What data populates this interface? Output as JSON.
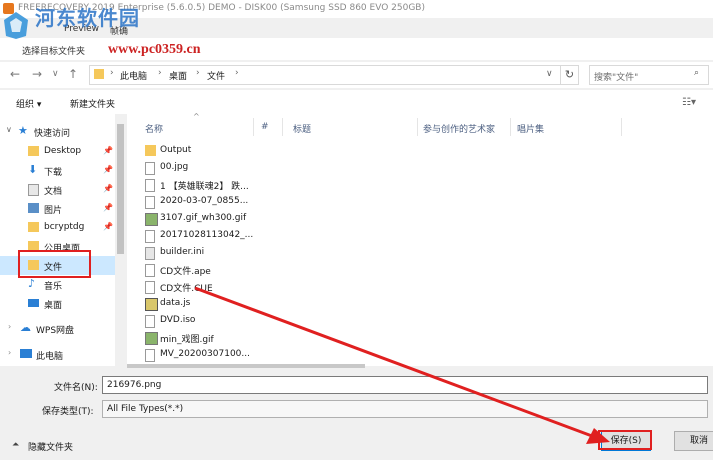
{
  "window": {
    "title": "FREERECOVERY 2019 Enterprise (5.6.0.5) DEMO - DISK00 (Samsung SSD 860 EVO 250GB)",
    "watermark_text": "河东软件园",
    "watermark_url": "www.pc0359.cn"
  },
  "subtitle": {
    "left": "选择目标文件夹",
    "middle": "Preview",
    "right": "帧确"
  },
  "address": {
    "crumbs": [
      "此电脑",
      "桌面",
      "文件"
    ],
    "search_placeholder": "搜索\"文件\""
  },
  "toolbar": {
    "organize": "组织 ▾",
    "new_folder": "新建文件夹"
  },
  "nav": {
    "items": [
      {
        "label": "快速访问",
        "icon": "star-icon"
      },
      {
        "label": "Desktop",
        "icon": "folder-icon"
      },
      {
        "label": "下载",
        "icon": "download-icon"
      },
      {
        "label": "文档",
        "icon": "document-icon"
      },
      {
        "label": "图片",
        "icon": "picture-icon"
      },
      {
        "label": "bcryptdg",
        "icon": "folder-icon"
      },
      {
        "label": "公用桌面",
        "icon": "folder-icon"
      },
      {
        "label": "文件",
        "icon": "folder-icon"
      },
      {
        "label": "音乐",
        "icon": "music-icon"
      },
      {
        "label": "桌面",
        "icon": "desktop-icon"
      },
      {
        "label": "WPS网盘",
        "icon": "cloud-icon"
      },
      {
        "label": "此电脑",
        "icon": "computer-icon"
      }
    ]
  },
  "columns": [
    "名称",
    "#",
    "标题",
    "参与创作的艺术家",
    "唱片集"
  ],
  "files": [
    {
      "name": "Output",
      "icon": "folder-icon"
    },
    {
      "name": "00.jpg",
      "icon": "file-icon"
    },
    {
      "name": "1 【英雄联魂2】 跌...",
      "icon": "file-icon"
    },
    {
      "name": "2020-03-07_0855...",
      "icon": "file-icon"
    },
    {
      "name": "3107.gif_wh300.gif",
      "icon": "image-icon"
    },
    {
      "name": "20171028113042_...",
      "icon": "file-icon"
    },
    {
      "name": "builder.ini",
      "icon": "settings-file-icon"
    },
    {
      "name": "CD文件.ape",
      "icon": "file-icon"
    },
    {
      "name": "CD文件.CUE",
      "icon": "file-icon"
    },
    {
      "name": "data.js",
      "icon": "script-file-icon"
    },
    {
      "name": "DVD.iso",
      "icon": "file-icon"
    },
    {
      "name": "min_戏图.gif",
      "icon": "image-icon"
    },
    {
      "name": "MV_20200307100...",
      "icon": "file-icon"
    }
  ],
  "form": {
    "filename_label": "文件名(N):",
    "filename_value": "216976.png",
    "filetype_label": "保存类型(T):",
    "filetype_value": "All File Types(*.*)",
    "hide_folders": "隐藏文件夹",
    "save": "保存(S)",
    "cancel": "取消"
  },
  "colors": {
    "accent": "#0078d7",
    "annotation": "#e02020",
    "selected_bg": "#cce8ff"
  }
}
